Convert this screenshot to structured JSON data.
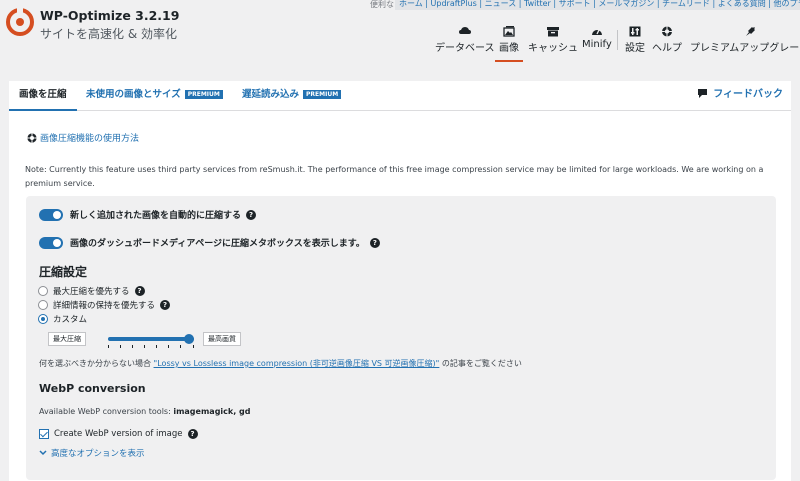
{
  "brand": {
    "title": "WP-Optimize 3.2.19",
    "subtitle": "サイトを高速化 & 効率化",
    "accent_color": "#d54e21"
  },
  "links": {
    "label": "便利なリンク",
    "items": "ホーム | UpdraftPlus | ニュース | Twitter | サポート | メールマガジン | チームリード | よくある質問 | 他のプラグイン"
  },
  "menu": [
    {
      "label": "データベース",
      "icon": "database-icon"
    },
    {
      "label": "画像",
      "icon": "images-icon",
      "active": true
    },
    {
      "label": "キャッシュ",
      "icon": "cache-icon"
    },
    {
      "label": "Minify",
      "icon": "minify-icon"
    },
    {
      "label": "設定",
      "icon": "settings-icon"
    },
    {
      "label": "ヘルプ",
      "icon": "help-icon"
    },
    {
      "label": "プレミアムアップグレード",
      "icon": "premium-icon"
    }
  ],
  "tabs": {
    "compress": "画像を圧縮",
    "unused": "未使用の画像とサイズ",
    "lazy": "遅延読み込み",
    "premium_badge": "PREMIUM",
    "feedback": "フィードバック"
  },
  "howto_link": "画像圧縮機能の使用方法",
  "note": "Note: Currently this feature uses third party services from reSmush.it. The performance of this free image compression service may be limited for large workloads. We are working on a premium service.",
  "options": {
    "auto_compress_label": "新しく追加された画像を自動的に圧縮する",
    "show_metabox_label": "画像のダッシュボードメディアページに圧縮メタボックスを表示します。",
    "auto_compress_on": true,
    "show_metabox_on": true
  },
  "compression": {
    "heading": "圧縮設定",
    "radios": [
      {
        "label": "最大圧縮を優先する",
        "checked": false,
        "help": true
      },
      {
        "label": "詳細情報の保持を優先する",
        "checked": false,
        "help": true
      },
      {
        "label": "カスタム",
        "checked": true,
        "help": false
      }
    ],
    "slider_min_label": "最大圧縮",
    "slider_max_label": "最高画質",
    "slider_value": 1.0,
    "which_prefix": "何を選ぶべきか分からない場合",
    "which_link": "\"Lossy vs Lossless image compression (非可逆画像圧縮 VS 可逆画像圧縮)\"",
    "which_suffix": "の記事をご覧ください"
  },
  "webp": {
    "heading": "WebP conversion",
    "tools_prefix": "Available WebP conversion tools:",
    "tools_value": "imagemagick, gd",
    "create_label": "Create WebP version of image",
    "create_checked": true,
    "advanced_label": "高度なオプションを表示"
  }
}
